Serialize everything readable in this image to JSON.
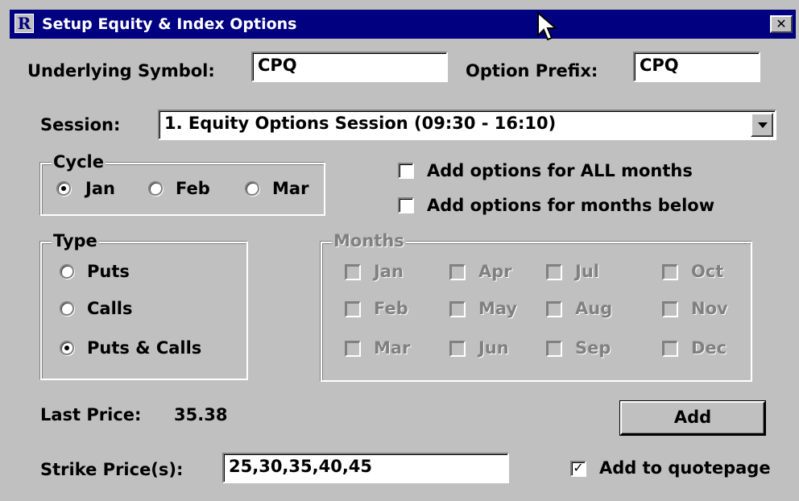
{
  "window": {
    "title": "Setup Equity & Index Options",
    "icon": "R",
    "close": "✕"
  },
  "underlying": {
    "label": "Underlying Symbol:",
    "value": "CPQ"
  },
  "prefix": {
    "label": "Option Prefix:",
    "value": "CPQ"
  },
  "session": {
    "label": "Session:",
    "value": "1. Equity Options Session (09:30 - 16:10)"
  },
  "cycle": {
    "legend": "Cycle",
    "options": [
      "Jan",
      "Feb",
      "Mar"
    ],
    "selected": "Jan"
  },
  "add_all_months": {
    "label": "Add options for ALL months",
    "checked": false
  },
  "add_months_below": {
    "label": "Add options for months below",
    "checked": false
  },
  "type": {
    "legend": "Type",
    "options": [
      "Puts",
      "Calls",
      "Puts & Calls"
    ],
    "selected": "Puts & Calls"
  },
  "months": {
    "legend": "Months",
    "enabled": false,
    "items": [
      "Jan",
      "Apr",
      "Jul",
      "Oct",
      "Feb",
      "May",
      "Aug",
      "Nov",
      "Mar",
      "Jun",
      "Sep",
      "Dec"
    ]
  },
  "last_price": {
    "label": "Last Price:",
    "value": "35.38"
  },
  "add_button": {
    "label": "Add"
  },
  "strike": {
    "label": "Strike Price(s):",
    "value": "25,30,35,40,45"
  },
  "add_to_quotepage": {
    "label": "Add to quotepage",
    "checked": true,
    "mark": "✓"
  }
}
